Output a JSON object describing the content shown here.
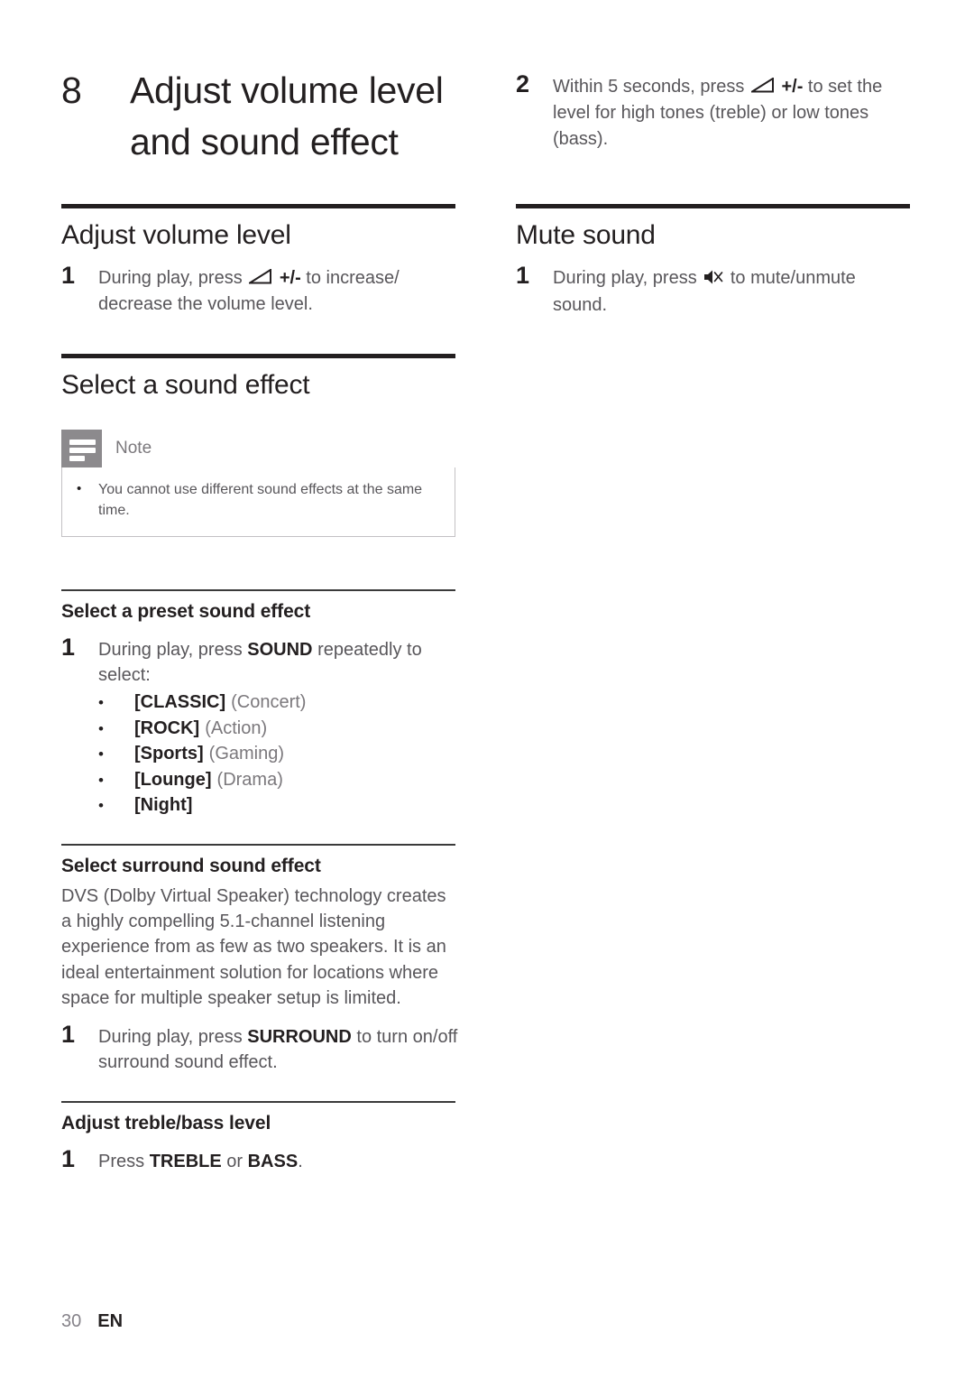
{
  "page": {
    "footer_page_number": "30",
    "footer_language": "EN",
    "text_color": "#58565a",
    "heading_color": "#231f20",
    "note_icon_color": "#8c8a8d"
  },
  "chapter": {
    "number": "8",
    "title": "Adjust volume level and sound effect"
  },
  "left_column": {
    "adjust_volume": {
      "heading": "Adjust volume level",
      "step1_number": "1",
      "step1_text_before": "During play, press",
      "step1_icon": "volume-wedge-icon",
      "step1_bold": "+/-",
      "step1_text_after": "to increase/ decrease the volume level."
    },
    "select_sound_effect": {
      "heading": "Select a sound effect",
      "note": {
        "icon": "note-lines-icon",
        "title": "Note",
        "bullet": "•",
        "text": "You cannot use different sound effects at the same time."
      }
    },
    "preset_sound_effect": {
      "heading": "Select a preset sound effect",
      "step1_number": "1",
      "step1_text_before": "During play, press",
      "step1_bold": "SOUND",
      "step1_text_after": "repeatedly to select:",
      "bullet": "•",
      "presets": [
        {
          "name": "[CLASSIC]",
          "desc": "(Concert)"
        },
        {
          "name": "[ROCK]",
          "desc": "(Action)"
        },
        {
          "name": "[Sports]",
          "desc": "(Gaming)"
        },
        {
          "name": "[Lounge]",
          "desc": "(Drama)"
        },
        {
          "name": "[Night]",
          "desc": ""
        }
      ]
    },
    "surround_sound_effect": {
      "heading": "Select surround sound effect",
      "paragraph": "DVS (Dolby Virtual Speaker) technology creates a highly compelling 5.1-channel listening experience from as few as two speakers. It is an ideal entertainment solution for locations where space for multiple speaker setup is limited.",
      "step1_number": "1",
      "step1_text_before": "During play, press",
      "step1_bold": "SURROUND",
      "step1_text_after": "to turn on/off surround sound effect."
    },
    "treble_bass": {
      "heading": "Adjust treble/bass level",
      "step1_number": "1",
      "step1_text_before": "Press",
      "step1_bold_a": "TREBLE",
      "step1_text_middle": "or",
      "step1_bold_b": "BASS",
      "step1_text_after": "."
    }
  },
  "right_column": {
    "continued_step": {
      "step2_number": "2",
      "step2_text_before": "Within 5 seconds, press",
      "step2_icon": "volume-wedge-icon",
      "step2_bold": "+/-",
      "step2_text_after": "to set the level for high tones (treble) or low tones (bass)."
    },
    "mute_sound": {
      "heading": "Mute sound",
      "step1_number": "1",
      "step1_text_before": "During play, press",
      "step1_icon": "mute-speaker-icon",
      "step1_text_after": "to mute/unmute sound."
    }
  }
}
